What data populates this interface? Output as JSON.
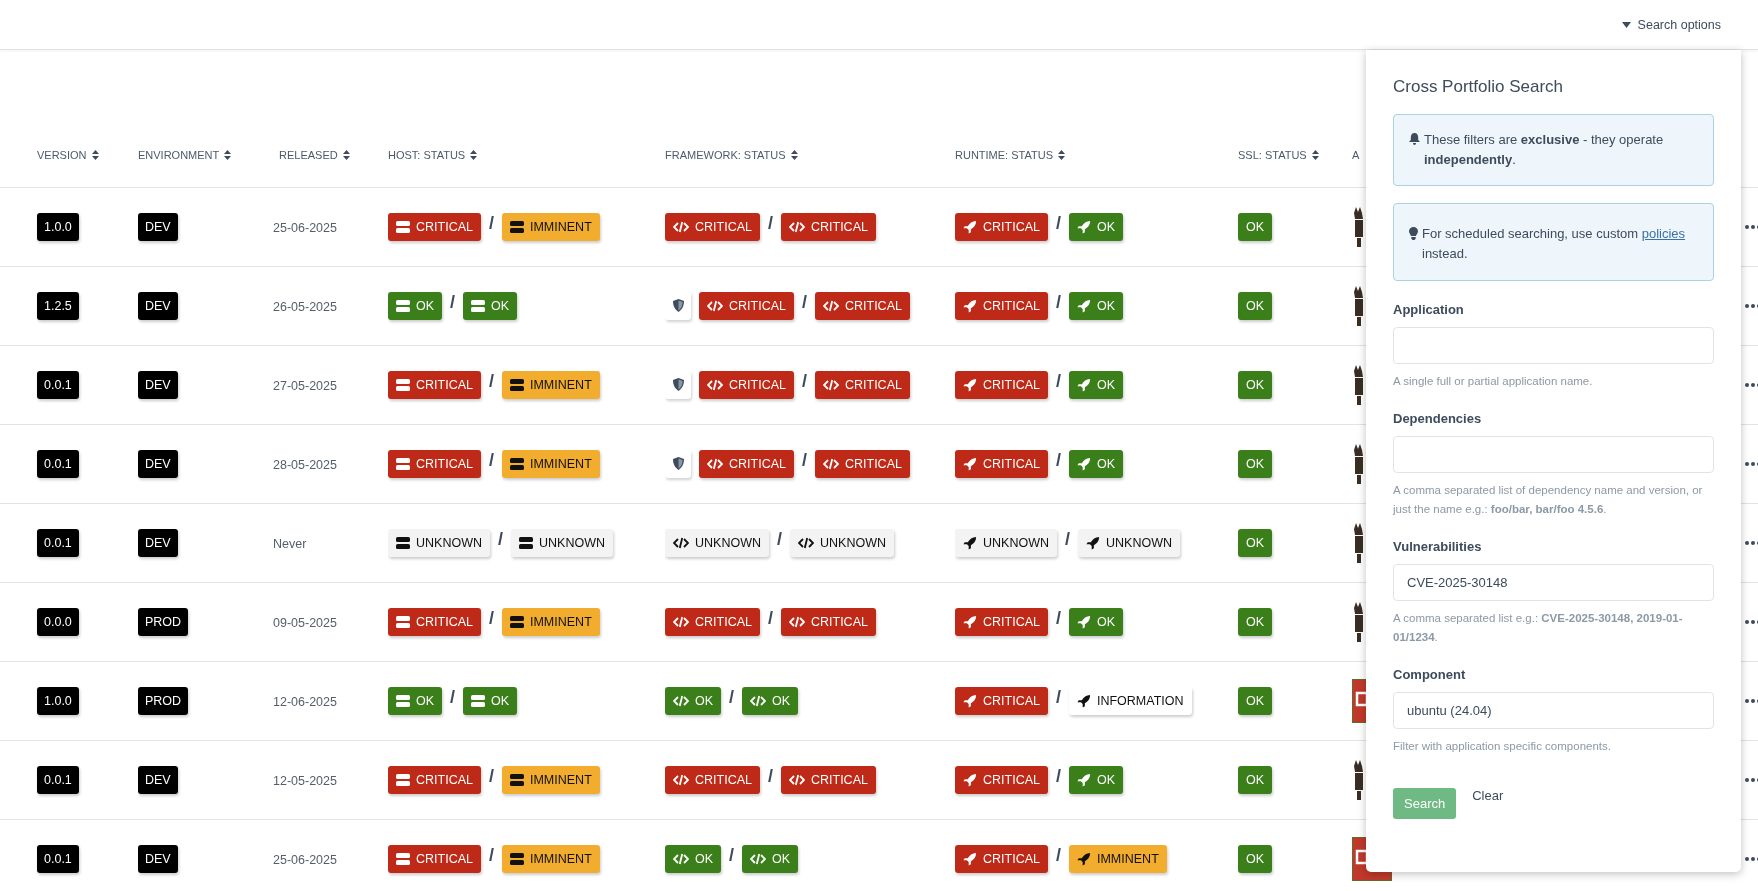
{
  "header": {
    "search_options": {
      "label": "Search options",
      "expanded": true
    }
  },
  "table": {
    "columns": [
      {
        "label": "VERSION",
        "sortable": true
      },
      {
        "label": "ENVIRONMENT",
        "sortable": true
      },
      {
        "label": "RELEASED",
        "sortable": true
      },
      {
        "label": "HOST: STATUS",
        "sortable": true
      },
      {
        "label": "FRAMEWORK: STATUS",
        "sortable": true
      },
      {
        "label": "RUNTIME: STATUS",
        "sortable": true
      },
      {
        "label": "SSL: STATUS",
        "sortable": true
      },
      {
        "label": "A",
        "sortable": false
      }
    ],
    "rows": [
      {
        "version": "1.0.0",
        "environment": "DEV",
        "released": "25-06-2025",
        "host": {
          "separator": "/",
          "badges": [
            {
              "kind": "critical",
              "label": "CRITICAL"
            },
            {
              "kind": "imminent",
              "label": "IMMINENT"
            }
          ]
        },
        "framework_shield": false,
        "framework": {
          "separator": "/",
          "badges": [
            {
              "kind": "critical",
              "label": "CRITICAL"
            },
            {
              "kind": "critical",
              "label": "CRITICAL"
            }
          ]
        },
        "runtime": {
          "separator": "/",
          "badges": [
            {
              "kind": "critical",
              "label": "CRITICAL"
            },
            {
              "kind": "ok",
              "label": "OK"
            }
          ]
        },
        "ssl": {
          "kind": "ok",
          "label": "OK"
        },
        "logo": {
          "kind": "figure"
        }
      },
      {
        "version": "1.2.5",
        "environment": "DEV",
        "released": "26-05-2025",
        "host": {
          "separator": "/",
          "badges": [
            {
              "kind": "ok",
              "label": "OK"
            },
            {
              "kind": "ok",
              "label": "OK"
            }
          ]
        },
        "framework_shield": true,
        "framework": {
          "separator": "/",
          "badges": [
            {
              "kind": "critical",
              "label": "CRITICAL"
            },
            {
              "kind": "critical",
              "label": "CRITICAL"
            }
          ]
        },
        "runtime": {
          "separator": "/",
          "badges": [
            {
              "kind": "critical",
              "label": "CRITICAL"
            },
            {
              "kind": "ok",
              "label": "OK"
            }
          ]
        },
        "ssl": {
          "kind": "ok",
          "label": "OK"
        },
        "logo": {
          "kind": "figure"
        }
      },
      {
        "version": "0.0.1",
        "environment": "DEV",
        "released": "27-05-2025",
        "host": {
          "separator": "/",
          "badges": [
            {
              "kind": "critical",
              "label": "CRITICAL"
            },
            {
              "kind": "imminent",
              "label": "IMMINENT"
            }
          ]
        },
        "framework_shield": true,
        "framework": {
          "separator": "/",
          "badges": [
            {
              "kind": "critical",
              "label": "CRITICAL"
            },
            {
              "kind": "critical",
              "label": "CRITICAL"
            }
          ]
        },
        "runtime": {
          "separator": "/",
          "badges": [
            {
              "kind": "critical",
              "label": "CRITICAL"
            },
            {
              "kind": "ok",
              "label": "OK"
            }
          ]
        },
        "ssl": {
          "kind": "ok",
          "label": "OK"
        },
        "logo": {
          "kind": "figure"
        }
      },
      {
        "version": "0.0.1",
        "environment": "DEV",
        "released": "28-05-2025",
        "host": {
          "separator": "/",
          "badges": [
            {
              "kind": "critical",
              "label": "CRITICAL"
            },
            {
              "kind": "imminent",
              "label": "IMMINENT"
            }
          ]
        },
        "framework_shield": true,
        "framework": {
          "separator": "/",
          "badges": [
            {
              "kind": "critical",
              "label": "CRITICAL"
            },
            {
              "kind": "critical",
              "label": "CRITICAL"
            }
          ]
        },
        "runtime": {
          "separator": "/",
          "badges": [
            {
              "kind": "critical",
              "label": "CRITICAL"
            },
            {
              "kind": "ok",
              "label": "OK"
            }
          ]
        },
        "ssl": {
          "kind": "ok",
          "label": "OK"
        },
        "logo": {
          "kind": "figure"
        }
      },
      {
        "version": "0.0.1",
        "environment": "DEV",
        "released": "Never",
        "host": {
          "separator": "/",
          "badges": [
            {
              "kind": "unknown",
              "label": "UNKNOWN"
            },
            {
              "kind": "unknown",
              "label": "UNKNOWN"
            }
          ]
        },
        "framework_shield": false,
        "framework": {
          "separator": "/",
          "badges": [
            {
              "kind": "unknown",
              "label": "UNKNOWN"
            },
            {
              "kind": "unknown",
              "label": "UNKNOWN"
            }
          ]
        },
        "runtime": {
          "separator": "/",
          "badges": [
            {
              "kind": "unknown",
              "label": "UNKNOWN"
            },
            {
              "kind": "unknown",
              "label": "UNKNOWN"
            }
          ]
        },
        "ssl": {
          "kind": "ok",
          "label": "OK"
        },
        "logo": {
          "kind": "figure"
        }
      },
      {
        "version": "0.0.0",
        "environment": "PROD",
        "released": "09-05-2025",
        "host": {
          "separator": "/",
          "badges": [
            {
              "kind": "critical",
              "label": "CRITICAL"
            },
            {
              "kind": "imminent",
              "label": "IMMINENT"
            }
          ]
        },
        "framework_shield": false,
        "framework": {
          "separator": "/",
          "badges": [
            {
              "kind": "critical",
              "label": "CRITICAL"
            },
            {
              "kind": "critical",
              "label": "CRITICAL"
            }
          ]
        },
        "runtime": {
          "separator": "/",
          "badges": [
            {
              "kind": "critical",
              "label": "CRITICAL"
            },
            {
              "kind": "ok",
              "label": "OK"
            }
          ]
        },
        "ssl": {
          "kind": "ok",
          "label": "OK"
        },
        "logo": {
          "kind": "figure"
        }
      },
      {
        "version": "1.0.0",
        "environment": "PROD",
        "released": "12-06-2025",
        "host": {
          "separator": "/",
          "badges": [
            {
              "kind": "ok",
              "label": "OK"
            },
            {
              "kind": "ok",
              "label": "OK"
            }
          ]
        },
        "framework_shield": false,
        "framework": {
          "separator": "/",
          "badges": [
            {
              "kind": "ok",
              "label": "OK"
            },
            {
              "kind": "ok",
              "label": "OK"
            }
          ]
        },
        "runtime": {
          "separator": "/",
          "badges": [
            {
              "kind": "critical",
              "label": "CRITICAL"
            },
            {
              "kind": "information",
              "label": "INFORMATION"
            }
          ]
        },
        "ssl": {
          "kind": "ok",
          "label": "OK"
        },
        "logo": {
          "kind": "square"
        }
      },
      {
        "version": "0.0.1",
        "environment": "DEV",
        "released": "12-05-2025",
        "host": {
          "separator": "/",
          "badges": [
            {
              "kind": "critical",
              "label": "CRITICAL"
            },
            {
              "kind": "imminent",
              "label": "IMMINENT"
            }
          ]
        },
        "framework_shield": false,
        "framework": {
          "separator": "/",
          "badges": [
            {
              "kind": "critical",
              "label": "CRITICAL"
            },
            {
              "kind": "critical",
              "label": "CRITICAL"
            }
          ]
        },
        "runtime": {
          "separator": "/",
          "badges": [
            {
              "kind": "critical",
              "label": "CRITICAL"
            },
            {
              "kind": "ok",
              "label": "OK"
            }
          ]
        },
        "ssl": {
          "kind": "ok",
          "label": "OK"
        },
        "logo": {
          "kind": "figure"
        }
      },
      {
        "version": "0.0.1",
        "environment": "DEV",
        "released": "25-06-2025",
        "host": {
          "separator": "/",
          "badges": [
            {
              "kind": "critical",
              "label": "CRITICAL"
            },
            {
              "kind": "imminent",
              "label": "IMMINENT"
            }
          ]
        },
        "framework_shield": false,
        "framework": {
          "separator": "/",
          "badges": [
            {
              "kind": "ok",
              "label": "OK"
            },
            {
              "kind": "ok",
              "label": "OK"
            }
          ]
        },
        "runtime": {
          "separator": "/",
          "badges": [
            {
              "kind": "critical",
              "label": "CRITICAL"
            },
            {
              "kind": "imminent",
              "label": "IMMINENT"
            }
          ]
        },
        "ssl": {
          "kind": "ok",
          "label": "OK"
        },
        "logo": {
          "kind": "square"
        }
      }
    ]
  },
  "search_panel": {
    "title": "Cross Portfolio Search",
    "notice": "These filters are **exclusive** - they operate **independently**.",
    "tip": {
      "before": "For scheduled searching, use custom",
      "link": "policies",
      "after": "instead."
    },
    "fields": [
      {
        "label": "Application",
        "help": "A single full or partial application name."
      },
      {
        "label": "Dependencies",
        "help": "A comma separated list of dependency name and version, or just the name e.g.: **foo/bar, bar/foo 4.5.6**."
      },
      {
        "label": "Vulnerabilities",
        "value": "CVE-2025-30148",
        "help": "A comma separated list e.g.: **CVE-2025-30148, 2019-01-01/1234**."
      },
      {
        "label": "Component",
        "value": "ubuntu (24.04)",
        "help": "Filter with application specific components."
      }
    ],
    "search_button": "Search",
    "clear_link": "Clear"
  }
}
